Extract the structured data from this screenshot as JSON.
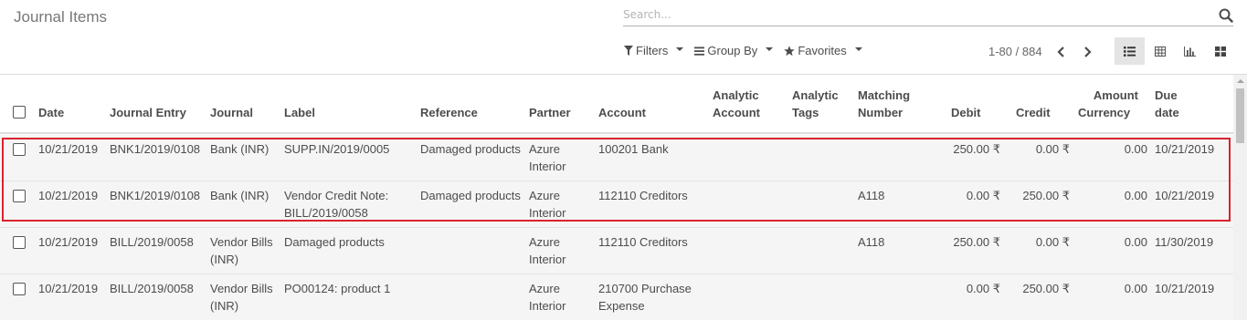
{
  "page": {
    "title": "Journal Items"
  },
  "search": {
    "placeholder": "Search..."
  },
  "toolbar": {
    "filters": "Filters",
    "group_by": "Group By",
    "favorites": "Favorites"
  },
  "pager": {
    "range": "1-80 / 884"
  },
  "headers": {
    "date": "Date",
    "journal_entry": "Journal Entry",
    "journal": "Journal",
    "label": "Label",
    "reference": "Reference",
    "partner": "Partner",
    "account": "Account",
    "analytic_account_1": "Analytic",
    "analytic_account_2": "Account",
    "analytic_tags_1": "Analytic",
    "analytic_tags_2": "Tags",
    "matching_1": "Matching",
    "matching_2": "Number",
    "debit": "Debit",
    "credit": "Credit",
    "amount_currency_1": "Amount",
    "amount_currency_2": "Currency",
    "due_1": "Due",
    "due_2": "date"
  },
  "rows": [
    {
      "date": "10/21/2019",
      "entry": "BNK1/2019/0108",
      "journal_1": "Bank (INR)",
      "journal_2": "",
      "label_1": "SUPP.IN/2019/0005",
      "label_2": "",
      "reference": "Damaged products",
      "partner_1": "Azure",
      "partner_2": "Interior",
      "account_1": "100201 Bank",
      "account_2": "",
      "matching": "",
      "debit": "250.00 ₹",
      "credit": "0.00 ₹",
      "amount_currency": "0.00",
      "due": "10/21/2019"
    },
    {
      "date": "10/21/2019",
      "entry": "BNK1/2019/0108",
      "journal_1": "Bank (INR)",
      "journal_2": "",
      "label_1": "Vendor Credit Note:",
      "label_2": "BILL/2019/0058",
      "reference": "Damaged products",
      "partner_1": "Azure",
      "partner_2": "Interior",
      "account_1": "112110 Creditors",
      "account_2": "",
      "matching": "A118",
      "debit": "0.00 ₹",
      "credit": "250.00 ₹",
      "amount_currency": "0.00",
      "due": "10/21/2019"
    },
    {
      "date": "10/21/2019",
      "entry": "BILL/2019/0058",
      "journal_1": "Vendor Bills",
      "journal_2": "(INR)",
      "label_1": "Damaged products",
      "label_2": "",
      "reference": "",
      "partner_1": "Azure",
      "partner_2": "Interior",
      "account_1": "112110 Creditors",
      "account_2": "",
      "matching": "A118",
      "debit": "250.00 ₹",
      "credit": "0.00 ₹",
      "amount_currency": "0.00",
      "due": "11/30/2019"
    },
    {
      "date": "10/21/2019",
      "entry": "BILL/2019/0058",
      "journal_1": "Vendor Bills",
      "journal_2": "(INR)",
      "label_1": "PO00124: product 1",
      "label_2": "",
      "reference": "",
      "partner_1": "Azure",
      "partner_2": "Interior",
      "account_1": "210700 Purchase",
      "account_2": "Expense",
      "matching": "",
      "debit": "0.00 ₹",
      "credit": "250.00 ₹",
      "amount_currency": "0.00",
      "due": "10/21/2019"
    }
  ],
  "icons": {
    "search": "search-icon",
    "filter": "filter-icon",
    "group_by": "list-lines-icon",
    "favorites": "star-icon",
    "prev": "chevron-left-icon",
    "next": "chevron-right-icon",
    "list_view": "list-view-icon",
    "pivot_view": "grid-icon",
    "graph_view": "bar-chart-icon",
    "kanban_view": "kanban-icon"
  },
  "colors": {
    "highlight": "#d9232e",
    "active_view_bg": "#e4e4e4"
  }
}
